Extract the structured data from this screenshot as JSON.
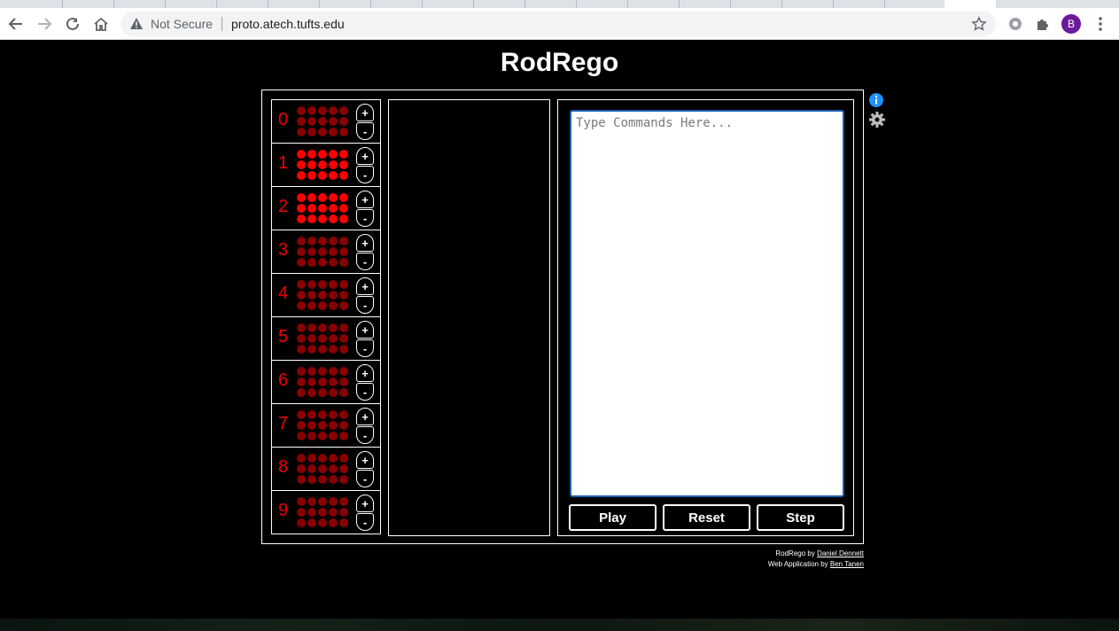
{
  "browser": {
    "security_label": "Not Secure",
    "url": "proto.atech.tufts.edu",
    "profile_initial": "B"
  },
  "app": {
    "title": "RodRego"
  },
  "registers": [
    {
      "label": "0",
      "count": 0
    },
    {
      "label": "1",
      "count": 15
    },
    {
      "label": "2",
      "count": 15
    },
    {
      "label": "3",
      "count": 0
    },
    {
      "label": "4",
      "count": 0
    },
    {
      "label": "5",
      "count": 0
    },
    {
      "label": "6",
      "count": 0
    },
    {
      "label": "7",
      "count": 0
    },
    {
      "label": "8",
      "count": 0
    },
    {
      "label": "9",
      "count": 0
    }
  ],
  "register_controls": {
    "plus": "+",
    "minus": "-"
  },
  "commands": {
    "placeholder": "Type Commands Here...",
    "value": ""
  },
  "buttons": {
    "play": "Play",
    "reset": "Reset",
    "step": "Step"
  },
  "credits": {
    "line1_prefix": "RodRego by",
    "line1_author": "Daniel Dennett",
    "line2_prefix": "Web Application by",
    "line2_author": "Ben Tanen"
  },
  "colors": {
    "dot_on": "#ff0000",
    "dot_off": "#880000",
    "register_number": "#ee0000",
    "info_icon": "#1e90ff"
  }
}
